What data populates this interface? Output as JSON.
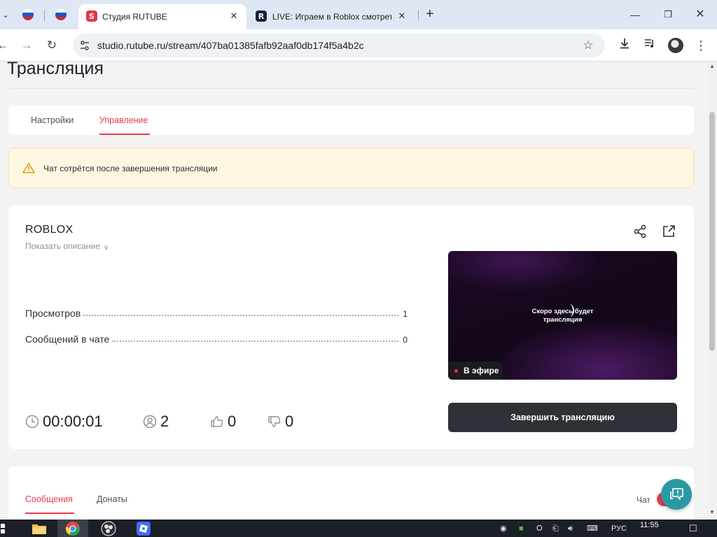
{
  "browser": {
    "tabs": [
      {
        "title": "",
        "icon": "russia-flag-icon"
      },
      {
        "title": "",
        "icon": "russia-flag-icon"
      },
      {
        "title": "Студия RUTUBE",
        "icon": "rutube-studio-icon",
        "active": true
      },
      {
        "title": "LIVE: Играем в Roblox смотреть",
        "icon": "rutube-icon",
        "active": false
      }
    ],
    "url": "studio.rutube.ru/stream/407ba01385fafb92aaf0db174f5a4b2c",
    "new_tab": "+"
  },
  "page": {
    "title": "Трансляция",
    "tabs": {
      "settings": "Настройки",
      "manage": "Управление"
    },
    "alert": "Чат сотрётся после завершения трансляции"
  },
  "stream": {
    "title": "ROBLOX",
    "show_description": "Показать описание",
    "stats": [
      {
        "label": "Просмотров",
        "value": "1"
      },
      {
        "label": "Сообщений в чате",
        "value": "0"
      }
    ],
    "counters": {
      "duration": "00:00:01",
      "viewers": "2",
      "likes": "0",
      "dislikes": "0"
    },
    "preview_text_line1": "Скоро здесь будет",
    "preview_text_line2": "трансляция",
    "live_badge": "В эфире",
    "end_button": "Завершить трансляцию"
  },
  "chat_panel": {
    "tabs": {
      "messages": "Сообщения",
      "donations": "Донаты"
    },
    "chat_label": "Чат"
  },
  "taskbar": {
    "lang": "РУС",
    "time": "11:55"
  },
  "colors": {
    "accent": "#ec3b4e",
    "button_dark": "#2d3238",
    "alert_bg": "#fdf6e1",
    "fab": "#2a9aa2"
  }
}
